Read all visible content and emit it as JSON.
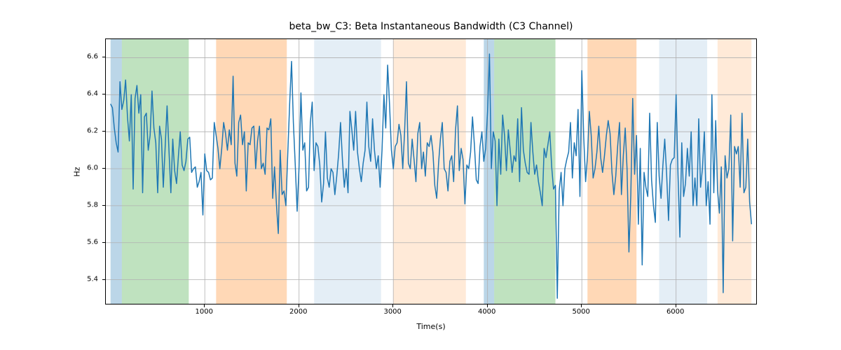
{
  "chart_data": {
    "type": "line",
    "title": "beta_bw_C3: Beta Instantaneous Bandwidth (C3 Channel)",
    "xlabel": "Time(s)",
    "ylabel": "Hz",
    "xlim": [
      -50,
      6850
    ],
    "ylim": [
      5.27,
      6.7
    ],
    "xticks": [
      1000,
      2000,
      3000,
      4000,
      5000,
      6000
    ],
    "yticks": [
      5.4,
      5.6,
      5.8,
      6.0,
      6.2,
      6.4,
      6.6
    ],
    "line_color": "#1f77b4",
    "grid": true,
    "bands": [
      {
        "x0": 0,
        "x1": 120,
        "color": "rgba(31,119,180,0.30)"
      },
      {
        "x0": 120,
        "x1": 830,
        "color": "rgba(44,160,44,0.30)"
      },
      {
        "x0": 1120,
        "x1": 1870,
        "color": "rgba(255,127,14,0.30)"
      },
      {
        "x0": 2160,
        "x1": 2870,
        "color": "rgba(31,119,180,0.12)"
      },
      {
        "x0": 3000,
        "x1": 3770,
        "color": "rgba(255,127,14,0.16)"
      },
      {
        "x0": 3960,
        "x1": 4070,
        "color": "rgba(31,119,180,0.30)"
      },
      {
        "x0": 4070,
        "x1": 4720,
        "color": "rgba(44,160,44,0.30)"
      },
      {
        "x0": 5060,
        "x1": 5580,
        "color": "rgba(255,127,14,0.30)"
      },
      {
        "x0": 5820,
        "x1": 6330,
        "color": "rgba(31,119,180,0.12)"
      },
      {
        "x0": 6440,
        "x1": 6800,
        "color": "rgba(255,127,14,0.16)"
      }
    ],
    "series": [
      {
        "name": "beta_bw_C3",
        "x_start": 0,
        "x_step": 20,
        "values": [
          6.35,
          6.33,
          6.22,
          6.14,
          6.09,
          6.47,
          6.32,
          6.37,
          6.48,
          6.28,
          6.15,
          6.4,
          5.89,
          6.38,
          6.45,
          6.3,
          6.4,
          5.87,
          6.28,
          6.3,
          6.1,
          6.18,
          6.42,
          6.22,
          6.14,
          5.87,
          6.23,
          6.16,
          5.9,
          6.12,
          6.34,
          6.1,
          5.87,
          6.16,
          5.99,
          5.92,
          6.07,
          6.2,
          6.02,
          5.99,
          6.04,
          6.16,
          6.17,
          5.98,
          6.0,
          6.01,
          5.9,
          5.93,
          5.98,
          5.75,
          6.08,
          5.99,
          5.98,
          5.94,
          5.95,
          6.25,
          6.18,
          6.11,
          6.0,
          6.11,
          6.25,
          6.19,
          6.1,
          6.21,
          6.13,
          6.5,
          6.03,
          5.96,
          6.25,
          6.29,
          6.13,
          6.2,
          5.88,
          6.14,
          6.13,
          6.22,
          6.23,
          6.0,
          6.15,
          6.23,
          6.0,
          6.03,
          5.97,
          6.22,
          6.21,
          6.27,
          5.84,
          6.01,
          5.81,
          5.65,
          6.1,
          5.86,
          5.88,
          5.8,
          6.08,
          6.35,
          6.58,
          6.25,
          6.02,
          5.77,
          6.01,
          6.41,
          6.1,
          6.14,
          5.88,
          5.9,
          6.25,
          6.36,
          5.99,
          6.14,
          6.12,
          6.02,
          5.82,
          5.92,
          6.2,
          5.95,
          5.9,
          6.0,
          5.98,
          5.86,
          5.96,
          6.08,
          6.25,
          6.05,
          5.9,
          6.0,
          5.87,
          6.31,
          6.21,
          6.1,
          6.31,
          6.09,
          6.0,
          5.93,
          6.03,
          6.1,
          6.36,
          6.12,
          6.04,
          6.27,
          6.1,
          6.0,
          6.07,
          5.9,
          6.1,
          6.4,
          6.22,
          6.56,
          6.35,
          6.1,
          6.0,
          6.12,
          6.14,
          6.24,
          6.18,
          6.0,
          6.2,
          6.47,
          6.03,
          6.0,
          6.16,
          6.05,
          5.93,
          6.19,
          6.25,
          6.0,
          6.09,
          5.96,
          6.14,
          6.12,
          6.18,
          6.09,
          5.91,
          5.84,
          6.03,
          6.16,
          6.25,
          6.0,
          5.98,
          5.88,
          6.04,
          6.07,
          5.93,
          6.21,
          6.34,
          5.99,
          6.11,
          6.05,
          5.81,
          6.02,
          6.0,
          6.09,
          6.28,
          6.13,
          5.94,
          5.92,
          6.12,
          6.2,
          6.04,
          6.11,
          6.31,
          6.62,
          6.0,
          6.2,
          6.15,
          5.8,
          6.16,
          5.97,
          6.29,
          6.18,
          5.99,
          6.21,
          6.1,
          5.98,
          6.07,
          6.04,
          6.27,
          5.93,
          6.33,
          6.1,
          6.03,
          5.98,
          5.97,
          6.25,
          6.09,
          5.97,
          6.02,
          5.93,
          5.87,
          5.8,
          6.11,
          6.06,
          6.13,
          6.2,
          6.01,
          5.89,
          5.91,
          5.3,
          5.88,
          5.98,
          5.8,
          6.0,
          6.05,
          6.09,
          6.25,
          5.95,
          6.14,
          6.07,
          6.32,
          5.85,
          6.53,
          6.17,
          5.93,
          6.07,
          6.31,
          6.18,
          5.95,
          6.0,
          6.09,
          6.23,
          6.06,
          5.98,
          6.07,
          6.18,
          6.26,
          6.19,
          5.98,
          5.86,
          5.96,
          6.12,
          6.25,
          5.86,
          6.07,
          6.22,
          6.0,
          5.55,
          5.86,
          6.38,
          5.97,
          6.18,
          5.7,
          6.11,
          5.48,
          5.98,
          5.9,
          5.85,
          6.3,
          5.94,
          5.8,
          5.71,
          6.25,
          5.96,
          5.84,
          6.02,
          6.16,
          5.97,
          5.72,
          6.02,
          6.05,
          6.06,
          6.4,
          5.97,
          5.63,
          6.14,
          5.85,
          5.92,
          6.11,
          5.96,
          6.2,
          5.8,
          5.95,
          5.8,
          6.27,
          5.9,
          6.0,
          6.2,
          5.8,
          5.93,
          5.7,
          6.4,
          5.87,
          6.26,
          5.88,
          5.76,
          6.01,
          5.33,
          6.07,
          5.95,
          6.0,
          6.29,
          5.61,
          6.12,
          6.08,
          6.12,
          5.9,
          6.3,
          5.87,
          5.9,
          6.16,
          5.82,
          5.7
        ]
      }
    ]
  }
}
